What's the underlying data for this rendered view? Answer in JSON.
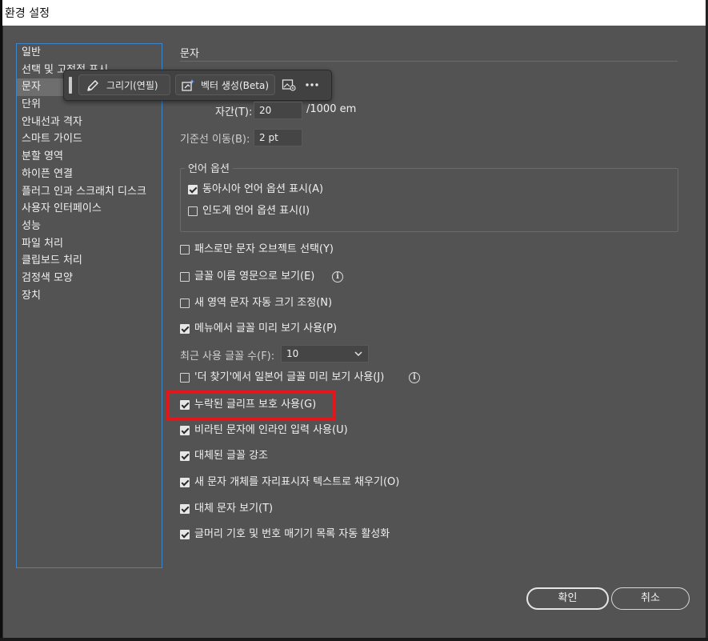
{
  "window": {
    "title": "환경 설정"
  },
  "sidebar": {
    "items": [
      {
        "label": "일반"
      },
      {
        "label": "선택 및 고정점 표시"
      },
      {
        "label": "문자"
      },
      {
        "label": "단위"
      },
      {
        "label": "안내선과 격자"
      },
      {
        "label": "스마트 가이드"
      },
      {
        "label": "분할 영역"
      },
      {
        "label": "하이픈 연결"
      },
      {
        "label": "플러그 인과 스크래치 디스크"
      },
      {
        "label": "사용자 인터페이스"
      },
      {
        "label": "성능"
      },
      {
        "label": "파일 처리"
      },
      {
        "label": "클립보드 처리"
      },
      {
        "label": "검정색 모양"
      },
      {
        "label": "장치"
      }
    ],
    "selected_index": 2
  },
  "floating_toolbar": {
    "draw_label": "그리기(연필)",
    "vector_label": "벡터 생성(Beta)",
    "draw_icon": "pencil-icon",
    "vector_icon": "generate-vector-icon",
    "image_icon": "image-settings-icon",
    "more_icon": "more-icon"
  },
  "type_section": {
    "title": "문자",
    "tracking_label": "자간(T):",
    "tracking_value": "20",
    "tracking_unit": "/1000 em",
    "baseline_label": "기준선 이동(B):",
    "baseline_value": "2 pt"
  },
  "language_options": {
    "legend": "언어 옵션",
    "east_asian": {
      "label": "동아시아 언어 옵션 표시(A)",
      "checked": true
    },
    "indic": {
      "label": "인도계 언어 옵션 표시(I)",
      "checked": false
    }
  },
  "options": {
    "path_only": {
      "label": "패스로만 문자 오브젝트 선택(Y)",
      "checked": false
    },
    "english_font_names": {
      "label": "글꼴 이름 영문으로 보기(E)",
      "checked": false
    },
    "auto_size_area": {
      "label": "새 영역 문자 자동 크기 조정(N)",
      "checked": false
    },
    "menu_font_preview": {
      "label": "메뉴에서 글꼴 미리 보기 사용(P)",
      "checked": true
    },
    "recent_fonts_label": "최근 사용 글꼴 수(F):",
    "recent_fonts_value": "10",
    "japanese_preview": {
      "label": "'더 찾기'에서 일본어 글꼴 미리 보기 사용(J)",
      "checked": false
    },
    "missing_glyph": {
      "label": "누락된 글리프 보호 사용(G)",
      "checked": true
    },
    "inline_input": {
      "label": "비라틴 문자에 인라인 입력 사용(U)",
      "checked": true
    },
    "substituted_font": {
      "label": "대체된 글꼴 강조",
      "checked": true
    },
    "fill_placeholder": {
      "label": "새 문자 개체를 자리표시자 텍스트로 채우기(O)",
      "checked": true
    },
    "show_alternates": {
      "label": "대체 문자 보기(T)",
      "checked": true
    },
    "auto_bullets": {
      "label": "글머리 기호 및 번호 매기기 목록 자동 활성화",
      "checked": true
    }
  },
  "buttons": {
    "ok": "확인",
    "cancel": "취소"
  },
  "colors": {
    "panel_bg": "#535353",
    "sidebar_border": "#3d84c9",
    "highlight": "#e3161b"
  }
}
